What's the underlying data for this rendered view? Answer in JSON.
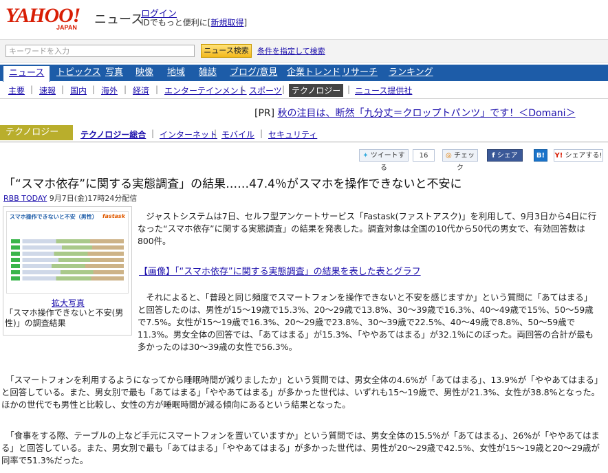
{
  "header": {
    "logo_text": "YAHOO!",
    "logo_sub": "JAPAN",
    "service": "ニュース",
    "login": "ログイン",
    "id_text": "IDでもっと便利に",
    "register": "新規取得",
    "register_bracket_open": "[",
    "register_bracket_close": "]"
  },
  "search": {
    "placeholder": "キーワードを入力",
    "button": "ニュース検索",
    "advanced": "条件を指定して検索"
  },
  "nav_main": [
    "ニュース",
    "トピックス",
    "写真",
    "映像",
    "地域",
    "雑誌",
    "ブログ/意見",
    "企業トレンド",
    "リサーチ",
    "ランキング"
  ],
  "nav_sub": [
    "主要",
    "速報",
    "国内",
    "海外",
    "経済",
    "エンターテインメント",
    "スポーツ",
    "テクノロジー",
    "ニュース提供社"
  ],
  "pr": {
    "label": "[PR]",
    "text": "秋の注目は、断然「九分丈＝クロップトパンツ」です！＜Domani＞"
  },
  "category": {
    "label": "テクノロジー",
    "links": [
      "テクノロジー総合",
      "インターネット",
      "モバイル",
      "セキュリティ"
    ]
  },
  "share": {
    "tweet": "ツイートする",
    "tweet_count": "16",
    "check": "チェック",
    "fb": "シェア",
    "hatena": "B!",
    "yahoo": "シェアする!"
  },
  "article": {
    "title": "「“スマホ依存”に関する実態調査」の結果……47.4％がスマホを操作できないと不安に",
    "source": "RBB TODAY",
    "date": "9月7日(金)17時24分配信",
    "photo_thumb_title": "スマホ操作できないと不安（男性）",
    "photo_thumb_brand": "fastask",
    "photo_enlarge": "拡大写真",
    "photo_caption": "「スマホ操作できないと不安(男性)」の調査結果",
    "para1": "　ジャストシステムは7日、セルフ型アンケートサービス「Fastask(ファストアスク)」を利用して、9月3日から4日に行なった“スマホ依存”に関する実態調査」の結果を発表した。調査対象は全国の10代から50代の男女で、有効回答数は800件。",
    "image_link": "【画像】「“スマホ依存”に関する実態調査」の結果を表した表とグラフ",
    "para2": "　それによると、「普段と同じ頻度でスマートフォンを操作できないと不安を感じますか」という質問に「あてはまる」と回答したのは、男性が15～19歳で15.3%、20～29歳で13.8%、30～39歳で16.3%、40～49歳で15%、50～59歳で7.5%。女性が15～19歳で16.3%、20～29歳で23.8%、30～39歳で22.5%、40～49歳で8.8%、50～59歳で11.3%。男女全体の回答では、「あてはまる」が15.3%、「ややあてはまる」が32.1％にのぼった。両回答の合計が最も多かったのは30～39歳の女性で56.3%。",
    "para3": "　「スマートフォンを利用するようになってから睡眠時間が減りましたか」という質問では、男女全体の4.6%が「あてはまる」、13.9%が「ややあてはまる」と回答している。また、男女別で最も「あてはまる」「ややあてはまる」が多かった世代は、いずれも15～19歳で、男性が21.3%、女性が38.8%となった。ほかの世代でも男性と比較し、女性の方が睡眠時間が減る傾向にあるという結果となった。",
    "para4": "　「食事をする際、テーブルの上など手元にスマートフォンを置いていますか」という質問では、男女全体の15.5%が「あてはまる」、26%が「ややあてはまる」と回答している。また、男女別で最も「あてはまる」「ややあてはまる」が多かった世代は、男性が20～29歳で42.5%、女性が15～19歳と20～29歳が同率で51.3%だった。"
  }
}
